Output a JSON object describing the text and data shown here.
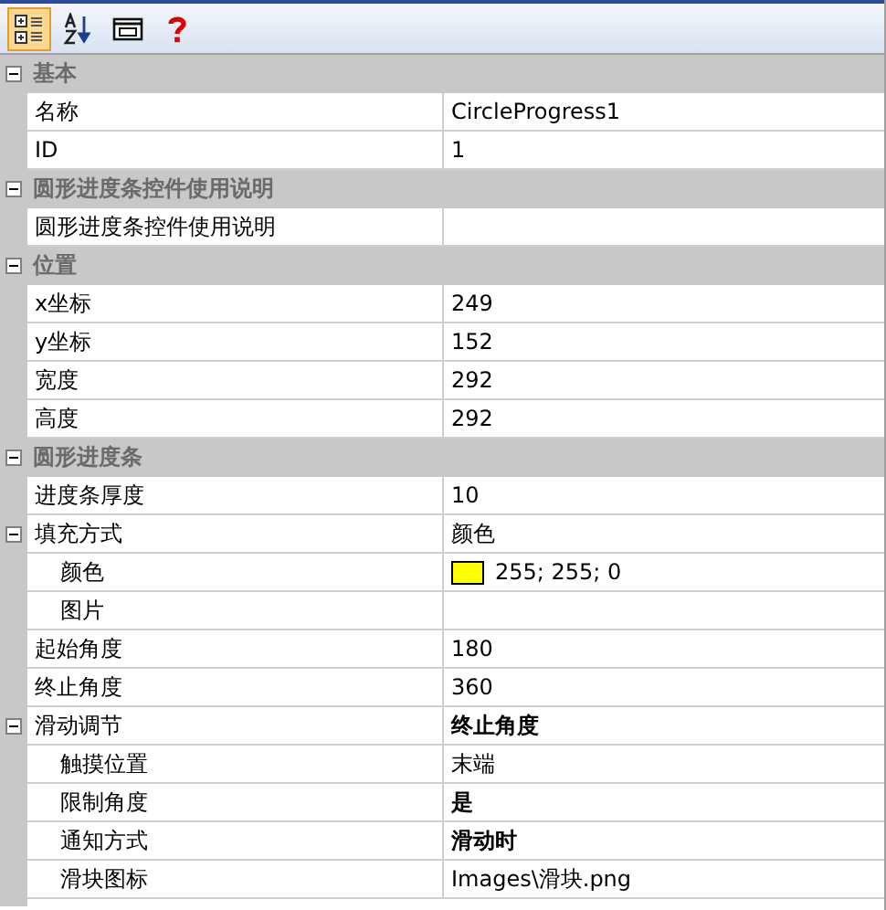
{
  "toolbar": [
    {
      "kind": "categorized",
      "selected": true
    },
    {
      "kind": "alphabetical",
      "selected": false
    },
    {
      "kind": "pages",
      "selected": false
    },
    {
      "kind": "help",
      "selected": false
    }
  ],
  "categories": [
    {
      "title": "基本",
      "expanded": true,
      "properties": [
        {
          "name": "名称",
          "value": "CircleProgress1",
          "modified": false
        },
        {
          "name": "ID",
          "value": "1",
          "modified": false
        }
      ]
    },
    {
      "title": "圆形进度条控件使用说明",
      "expanded": true,
      "properties": [
        {
          "name": "圆形进度条控件使用说明",
          "modified": false
        }
      ]
    },
    {
      "title": "位置",
      "expanded": true,
      "properties": [
        {
          "name": "x坐标",
          "value": "249",
          "modified": false
        },
        {
          "name": "y坐标",
          "value": "152",
          "modified": false
        },
        {
          "name": "宽度",
          "value": "292",
          "modified": false
        },
        {
          "name": "高度",
          "value": "292",
          "modified": false
        }
      ]
    },
    {
      "title": "圆形进度条",
      "expanded": true,
      "properties": [
        {
          "name": "进度条厚度",
          "value": "10",
          "modified": false
        },
        {
          "name": "填充方式",
          "value": "颜色",
          "modified": false,
          "expanded": true,
          "children": [
            {
              "name": "颜色",
              "kind": "color",
              "color": "#ffff00",
              "value": "255; 255; 0",
              "modified": false
            },
            {
              "name": "图片",
              "modified": false
            }
          ]
        },
        {
          "name": "起始角度",
          "value": "180",
          "modified": false
        },
        {
          "name": "终止角度",
          "value": "360",
          "modified": false
        },
        {
          "name": "滑动调节",
          "value": "终止角度",
          "modified": true,
          "expanded": true,
          "children": [
            {
              "name": "触摸位置",
              "value": "末端",
              "modified": false
            },
            {
              "name": "限制角度",
              "value": "是",
              "modified": true
            },
            {
              "name": "通知方式",
              "value": "滑动时",
              "modified": true
            },
            {
              "name": "滑块图标",
              "value": "Images\\滑块.png",
              "modified": false
            }
          ]
        }
      ]
    }
  ]
}
